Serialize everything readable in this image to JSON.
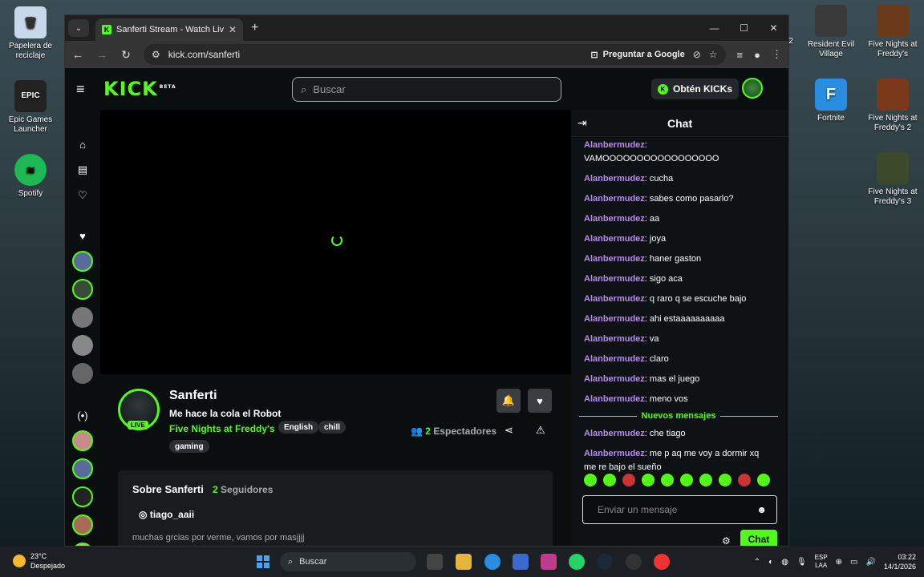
{
  "desktop": {
    "left_icons": [
      {
        "label": "Papelera de reciclaje",
        "color": "#c8d8e8"
      },
      {
        "label": "Epic Games Launcher",
        "color": "#222222"
      },
      {
        "label": "Spotify",
        "color": "#1db954"
      }
    ],
    "right_icons": [
      {
        "label": "Resident Evil Village",
        "color": "#3a3a3a"
      },
      {
        "label": "Five Nights at Freddy's",
        "color": "#6b3a1a"
      },
      {
        "label": "Fortnite",
        "color": "#2a8ee0"
      },
      {
        "label": "Five Nights at Freddy's 2",
        "color": "#7a3a1a"
      },
      {
        "label": "Five Nights at Freddy's 3",
        "color": "#3a4a2a"
      }
    ],
    "partial_label": "2"
  },
  "browser": {
    "tab_title": "Sanferti Stream - Watch Live on",
    "url": "kick.com/sanferti",
    "ask_google": "Preguntar a Google"
  },
  "kick": {
    "logo": "KICK",
    "beta": "BETA",
    "search_placeholder": "Buscar",
    "get_kicks": "Obtén KICKs",
    "accent": "#53fc18"
  },
  "channel": {
    "name": "Sanferti",
    "title": "Me hace la cola el Robot",
    "game": "Five Nights at Freddy's",
    "tags": [
      "English",
      "chill",
      "gaming"
    ],
    "live": "LIVE",
    "viewers_count": "2",
    "viewers_label": "Espectadores",
    "about_title": "Sobre Sanferti",
    "followers_count": "2",
    "followers_label": "Seguidores",
    "instagram": "tiago_aaii",
    "description": "muchas grcias por verme, vamos por masjjjj"
  },
  "chat": {
    "title": "Chat",
    "messages": [
      {
        "user": "Alanbermudez",
        "text": "VAMOOOOOOOOOOOOOOOOO"
      },
      {
        "user": "Alanbermudez",
        "text": "cucha"
      },
      {
        "user": "Alanbermudez",
        "text": "sabes como pasarlo?"
      },
      {
        "user": "Alanbermudez",
        "text": "aa"
      },
      {
        "user": "Alanbermudez",
        "text": "joya"
      },
      {
        "user": "Alanbermudez",
        "text": "haner gaston"
      },
      {
        "user": "Alanbermudez",
        "text": "sigo aca"
      },
      {
        "user": "Alanbermudez",
        "text": "q raro q se escuche bajo"
      },
      {
        "user": "Alanbermudez",
        "text": "ahi estaaaaaaaaaa"
      },
      {
        "user": "Alanbermudez",
        "text": "va"
      },
      {
        "user": "Alanbermudez",
        "text": "claro"
      },
      {
        "user": "Alanbermudez",
        "text": "mas el juego"
      },
      {
        "user": "Alanbermudez",
        "text": "meno vos"
      }
    ],
    "new_messages_label": "Nuevos mensajes",
    "new_messages": [
      {
        "user": "Alanbermudez",
        "text": "che tiago"
      },
      {
        "user": "Alanbermudez",
        "text": "me p aq me voy a dormir xq me re bajo el sueño"
      }
    ],
    "input_placeholder": "Enviar un mensaje",
    "send_label": "Chat"
  },
  "taskbar": {
    "temp": "23°C",
    "weather": "Despejado",
    "search": "Buscar",
    "lang_1": "ESP",
    "lang_2": "LAA",
    "time": "03:22",
    "date": "14/1/2026"
  }
}
